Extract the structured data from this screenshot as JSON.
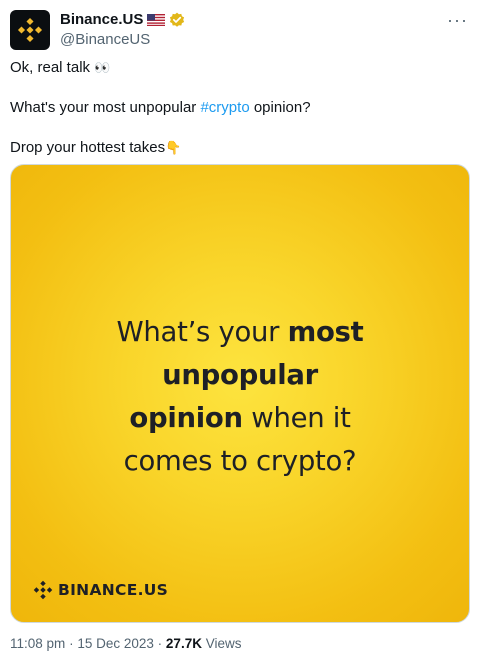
{
  "author": {
    "display_name": "Binance.US",
    "handle": "@BinanceUS",
    "avatar_icon": "binance-logo-icon",
    "flag_icon": "us-flag-icon",
    "verified_icon": "gold-verified-badge-icon"
  },
  "more_icon": "···",
  "tweet": {
    "line1": "Ok, real talk",
    "line1_emoji": "👀",
    "line2_before": "What's your most unpopular",
    "hashtag": "#crypto",
    "line2_after": "opinion?",
    "line3": "Drop your hottest takes",
    "line3_emoji": "👇"
  },
  "media": {
    "headline_part1": "What’s your",
    "headline_bold1": "most",
    "headline_bold2": "unpopular",
    "headline_bold3": "opinion",
    "headline_part2": "when it",
    "headline_part3": "comes to crypto?",
    "logo_text": "BINANCE.US"
  },
  "meta": {
    "time": "11:08 pm",
    "separator": "·",
    "date": "15 Dec 2023",
    "views_count": "27.7K",
    "views_label": "Views"
  },
  "colors": {
    "brand_yellow": "#f3ba2f",
    "link_blue": "#1d9bf0",
    "secondary_text": "#536471"
  }
}
